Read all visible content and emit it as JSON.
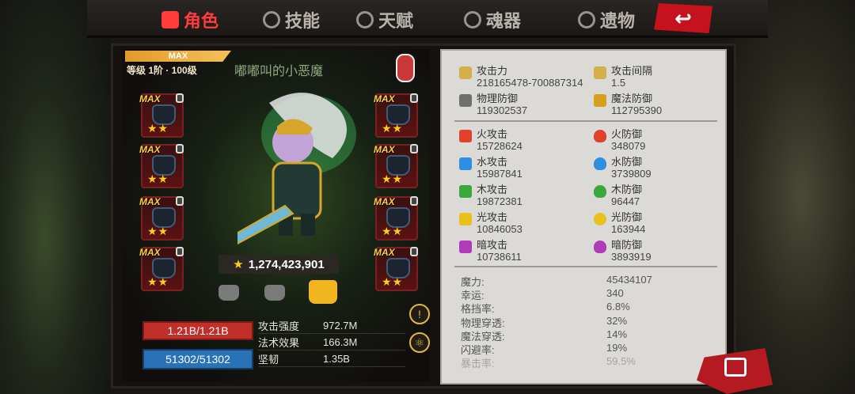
{
  "tabs": [
    {
      "label": "角色",
      "icon": "crown-icon",
      "active": true
    },
    {
      "label": "技能",
      "icon": "skill-icon",
      "active": false
    },
    {
      "label": "天赋",
      "icon": "talent-icon",
      "active": false
    },
    {
      "label": "魂器",
      "icon": "soul-icon",
      "active": false
    },
    {
      "label": "遗物",
      "icon": "relic-icon",
      "active": false
    }
  ],
  "hero": {
    "max_label": "MAX",
    "level_text": "等级 1阶 · 100级",
    "name": "嘟嘟叫的小恶魔",
    "power": "1,274,423,901"
  },
  "equipment": {
    "max_label": "MAX",
    "stars": "★★"
  },
  "bars": {
    "hp": "1.21B/1.21B",
    "mp": "51302/51302"
  },
  "mini_stats": [
    {
      "label": "攻击强度",
      "value": "972.7M"
    },
    {
      "label": "法术效果",
      "value": "166.3M"
    },
    {
      "label": "坚韧",
      "value": "1.35B"
    }
  ],
  "stats": {
    "main": [
      {
        "name": "攻击力",
        "value": "218165478-700887314",
        "color": "#d4b04a"
      },
      {
        "name": "攻击间隔",
        "value": "1.5",
        "color": "#d4b04a"
      },
      {
        "name": "物理防御",
        "value": "119302537",
        "color": "#6f6f6f"
      },
      {
        "name": "魔法防御",
        "value": "112795390",
        "color": "#d4a21a"
      }
    ],
    "elements": [
      {
        "name": "火攻击",
        "value": "15728624",
        "color": "#e0412a"
      },
      {
        "name": "火防御",
        "value": "348079",
        "color": "#e0412a"
      },
      {
        "name": "水攻击",
        "value": "15987841",
        "color": "#2d8fe0"
      },
      {
        "name": "水防御",
        "value": "3739809",
        "color": "#2d8fe0"
      },
      {
        "name": "木攻击",
        "value": "19872381",
        "color": "#3aa83a"
      },
      {
        "name": "木防御",
        "value": "96447",
        "color": "#3aa83a"
      },
      {
        "name": "光攻击",
        "value": "10846053",
        "color": "#e8c21a"
      },
      {
        "name": "光防御",
        "value": "163944",
        "color": "#e8c21a"
      },
      {
        "name": "暗攻击",
        "value": "10738611",
        "color": "#b03ab8"
      },
      {
        "name": "暗防御",
        "value": "3893919",
        "color": "#b03ab8"
      }
    ],
    "list": [
      {
        "label": "魔力:",
        "value": "45434107"
      },
      {
        "label": "幸运:",
        "value": "340"
      },
      {
        "label": "格挡率:",
        "value": "6.8%"
      },
      {
        "label": "物理穿透:",
        "value": "32%"
      },
      {
        "label": "魔法穿透:",
        "value": "14%"
      },
      {
        "label": "闪避率:",
        "value": "19%"
      },
      {
        "label": "暴击率:",
        "value": "59.5%"
      }
    ]
  },
  "colors": {
    "accent": "#ff3b3b",
    "hp": "#c0302a",
    "mp": "#2a72b8",
    "star": "#ffcc18"
  }
}
